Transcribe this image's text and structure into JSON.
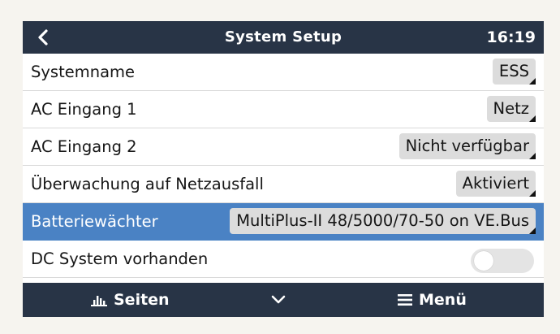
{
  "header": {
    "back_icon": "chevron-left-icon",
    "title": "System Setup",
    "time": "16:19"
  },
  "settings": [
    {
      "label": "Systemname",
      "value": "ESS",
      "type": "select"
    },
    {
      "label": "AC Eingang 1",
      "value": "Netz",
      "type": "select"
    },
    {
      "label": "AC Eingang 2",
      "value": "Nicht verfügbar",
      "type": "select"
    },
    {
      "label": "Überwachung auf Netzausfall",
      "value": "Aktiviert",
      "type": "select"
    },
    {
      "label": "Batteriewächter",
      "value": "MultiPlus-II 48/5000/70-50 on VE.Bus",
      "type": "select",
      "selected": true
    },
    {
      "label": "DC System vorhanden",
      "value": false,
      "type": "toggle"
    }
  ],
  "footer": {
    "pages_label": "Seiten",
    "pages_icon": "bar-chart-icon",
    "down_icon": "chevron-down-icon",
    "menu_label": "Menü",
    "menu_icon": "hamburger-menu-icon"
  },
  "colors": {
    "bar_background": "#283446",
    "selection": "#4a82c4",
    "value_box": "#dcdcdc"
  }
}
